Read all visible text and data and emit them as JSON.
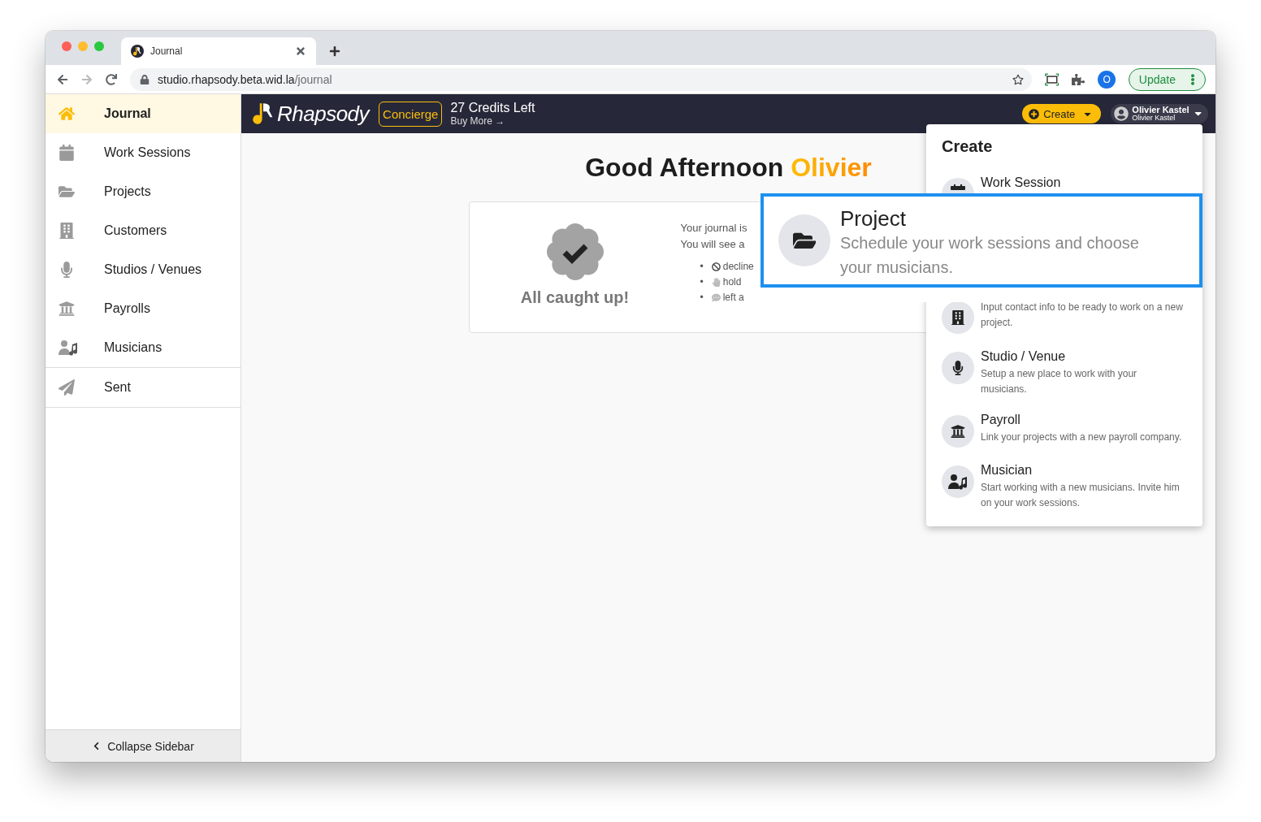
{
  "browser": {
    "tab_title": "Journal",
    "url_host": "studio.rhapsody.beta.wid.la",
    "url_path": "/journal",
    "profile_initial": "O",
    "update_label": "Update"
  },
  "sidebar": {
    "items": [
      {
        "label": "Journal",
        "selected": true
      },
      {
        "label": "Work Sessions",
        "selected": false
      },
      {
        "label": "Projects",
        "selected": false
      },
      {
        "label": "Customers",
        "selected": false
      },
      {
        "label": "Studios / Venues",
        "selected": false
      },
      {
        "label": "Payrolls",
        "selected": false
      },
      {
        "label": "Musicians",
        "selected": false
      },
      {
        "label": "Sent",
        "selected": false
      }
    ],
    "collapse_label": "Collapse Sidebar"
  },
  "header": {
    "logo": "Rhapsody",
    "badge": "Concierge",
    "credits": "27 Credits Left",
    "buy_more": "Buy More →",
    "create_button": "Create",
    "user_name": "Olivier Kastel",
    "user_subtitle": "Olivier Kastel"
  },
  "greeting": {
    "text": "Good Afternoon",
    "name": "Olivier"
  },
  "journal_card": {
    "status": "All caught up!",
    "lines": [
      "Your journal is",
      "You will see a"
    ],
    "bullet": "•",
    "list": [
      "decline",
      "hold",
      "left a"
    ]
  },
  "create_menu": {
    "title": "Create",
    "items": [
      {
        "title": "Work Session"
      },
      {
        "description": "Input contact info to be ready to work on a new project."
      },
      {
        "title": "Studio / Venue",
        "description": "Setup a new place to work with your musicians."
      },
      {
        "title": "Payroll",
        "description": "Link your projects with a new payroll company."
      },
      {
        "title": "Musician",
        "description": "Start working with a new musicians. Invite him on your work sessions."
      }
    ]
  },
  "callout": {
    "title": "Project",
    "description": "Schedule your work sessions and choose your musicians."
  }
}
